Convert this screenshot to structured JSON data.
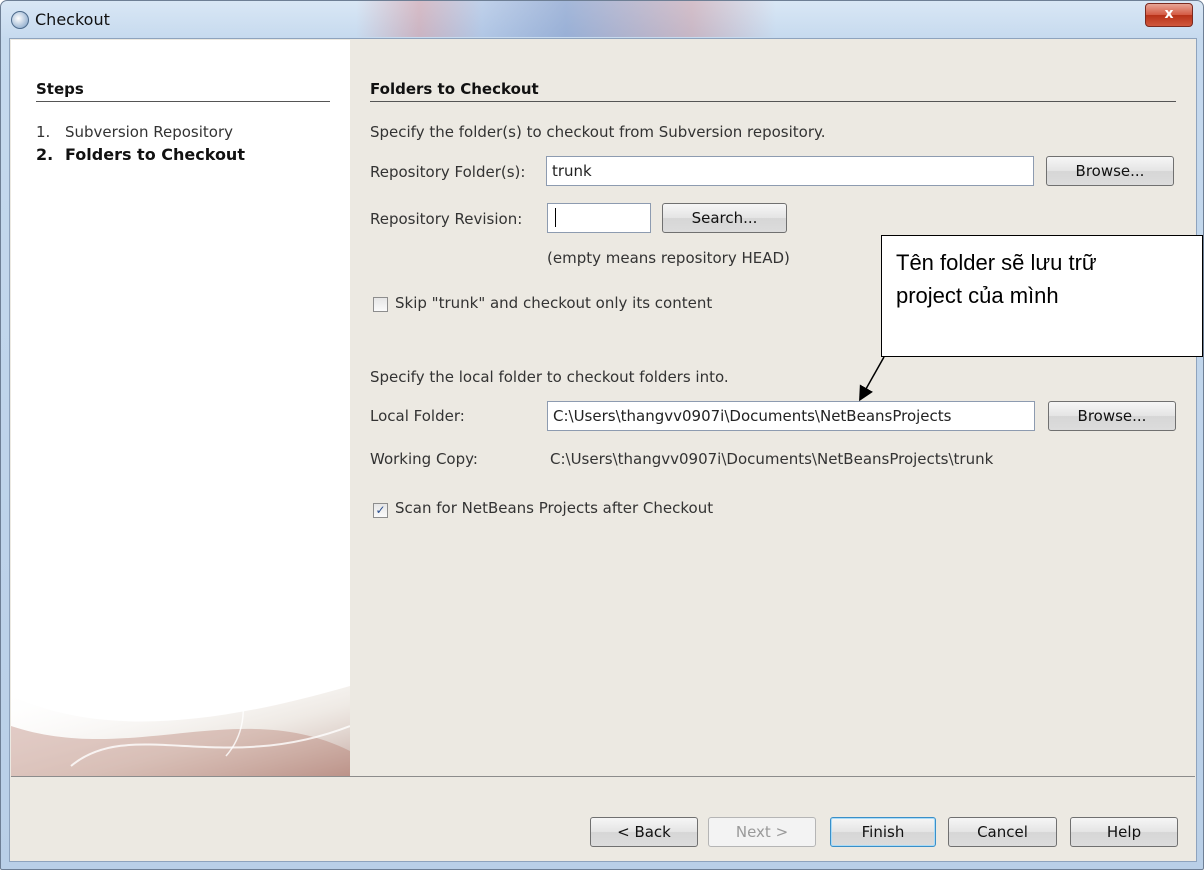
{
  "window": {
    "title": "Checkout",
    "close_label": "x"
  },
  "steps": {
    "title": "Steps",
    "items": [
      {
        "num": "1.",
        "label": "Subversion Repository"
      },
      {
        "num": "2.",
        "label": "Folders to Checkout"
      }
    ]
  },
  "main": {
    "section_title": "Folders to Checkout",
    "specify_text": "Specify the folder(s) to checkout from Subversion repository.",
    "repo_folder_label": "Repository Folder(s):",
    "repo_folder_value": "trunk",
    "browse_label": "Browse...",
    "revision_label": "Repository Revision:",
    "revision_value": "",
    "search_label": "Search...",
    "revision_hint": "(empty means repository HEAD)",
    "skip_trunk_label": "Skip \"trunk\" and checkout only its content",
    "skip_trunk_checked": false,
    "local_specify_text": "Specify the local folder to checkout folders into.",
    "local_folder_label": "Local Folder:",
    "local_folder_value": "C:\\Users\\thangvv0907i\\Documents\\NetBeansProjects",
    "browse2_label": "Browse...",
    "working_copy_label": "Working Copy:",
    "working_copy_value": "C:\\Users\\thangvv0907i\\Documents\\NetBeansProjects\\trunk",
    "scan_label": "Scan for NetBeans Projects after Checkout",
    "scan_checked": true,
    "check_mark": "✓"
  },
  "footer": {
    "back": "< Back",
    "next": "Next >",
    "finish": "Finish",
    "cancel": "Cancel",
    "help": "Help"
  },
  "annotation": {
    "line1": "Tên folder sẽ lưu trữ",
    "line2": "project của mình"
  }
}
